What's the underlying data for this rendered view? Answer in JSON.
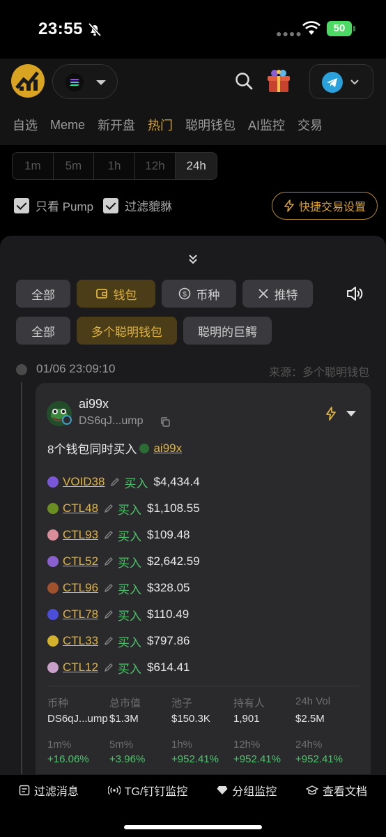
{
  "status_bar": {
    "time": "23:55",
    "battery": "50"
  },
  "header": {
    "icons": [
      "logo-icon",
      "solana-icon",
      "search-icon",
      "gift-icon",
      "telegram-icon"
    ]
  },
  "nav_tabs": [
    {
      "label": "自选",
      "active": false
    },
    {
      "label": "Meme",
      "active": false
    },
    {
      "label": "新开盘",
      "active": false
    },
    {
      "label": "热门",
      "active": true
    },
    {
      "label": "聪明钱包",
      "active": false
    },
    {
      "label": "AI监控",
      "active": false
    },
    {
      "label": "交易",
      "active": false
    }
  ],
  "time_filters": [
    {
      "label": "1m",
      "active": false
    },
    {
      "label": "5m",
      "active": false
    },
    {
      "label": "1h",
      "active": false
    },
    {
      "label": "12h",
      "active": false
    },
    {
      "label": "24h",
      "active": true
    }
  ],
  "checks": [
    {
      "label": "只看 Pump",
      "checked": true
    },
    {
      "label": "过滤貔貅",
      "checked": true
    }
  ],
  "quick_trade_label": "快捷交易设置",
  "filters_row1": [
    {
      "label": "全部",
      "active": false
    },
    {
      "label": "钱包",
      "active": true
    },
    {
      "label": "币种",
      "active": false
    },
    {
      "label": "推特",
      "active": false
    }
  ],
  "filters_row2": [
    {
      "label": "全部",
      "active": false
    },
    {
      "label": "多个聪明钱包",
      "active": true
    },
    {
      "label": "聪明的巨鳄",
      "active": false
    }
  ],
  "event": {
    "time": "01/06 23:09:10",
    "source": "来源：多个聪明钱包",
    "token_name": "ai99x",
    "token_addr": "DS6qJ...ump",
    "summary_prefix": "8个钱包同时买入",
    "summary_token": "ai99x",
    "buys": [
      {
        "wallet": "VOID38",
        "action": "买入",
        "amount": "$4,434.4",
        "color": "#7a56d8"
      },
      {
        "wallet": "CTL48",
        "action": "买入",
        "amount": "$1,108.55",
        "color": "#6b8e23"
      },
      {
        "wallet": "CTL93",
        "action": "买入",
        "amount": "$109.48",
        "color": "#d98c9a"
      },
      {
        "wallet": "CTL52",
        "action": "买入",
        "amount": "$2,642.59",
        "color": "#8a5fd0"
      },
      {
        "wallet": "CTL96",
        "action": "买入",
        "amount": "$328.05",
        "color": "#a0522d"
      },
      {
        "wallet": "CTL78",
        "action": "买入",
        "amount": "$110.49",
        "color": "#4b4fd8"
      },
      {
        "wallet": "CTL33",
        "action": "买入",
        "amount": "$797.86",
        "color": "#d4b32c"
      },
      {
        "wallet": "CTL12",
        "action": "买入",
        "amount": "$614.41",
        "color": "#c9a0c9"
      }
    ],
    "stats": {
      "headers": [
        "币种",
        "总市值",
        "池子",
        "持有人",
        "24h Vol"
      ],
      "values": [
        "DS6qJ...ump",
        "$1.3M",
        "$150.3K",
        "1,901",
        "$2.5M"
      ]
    },
    "changes": {
      "headers": [
        "1m%",
        "5m%",
        "1h%",
        "12h%",
        "24h%"
      ],
      "values": [
        "+16.06%",
        "+3.96%",
        "+952.41%",
        "+952.41%",
        "+952.41%"
      ]
    }
  },
  "bottom_bar": [
    {
      "label": "过滤消息",
      "icon": "filter-doc-icon"
    },
    {
      "label": "TG/钉钉监控",
      "icon": "broadcast-icon"
    },
    {
      "label": "分组监控",
      "icon": "diamond-icon"
    },
    {
      "label": "查看文档",
      "icon": "graduation-cap-icon"
    }
  ]
}
